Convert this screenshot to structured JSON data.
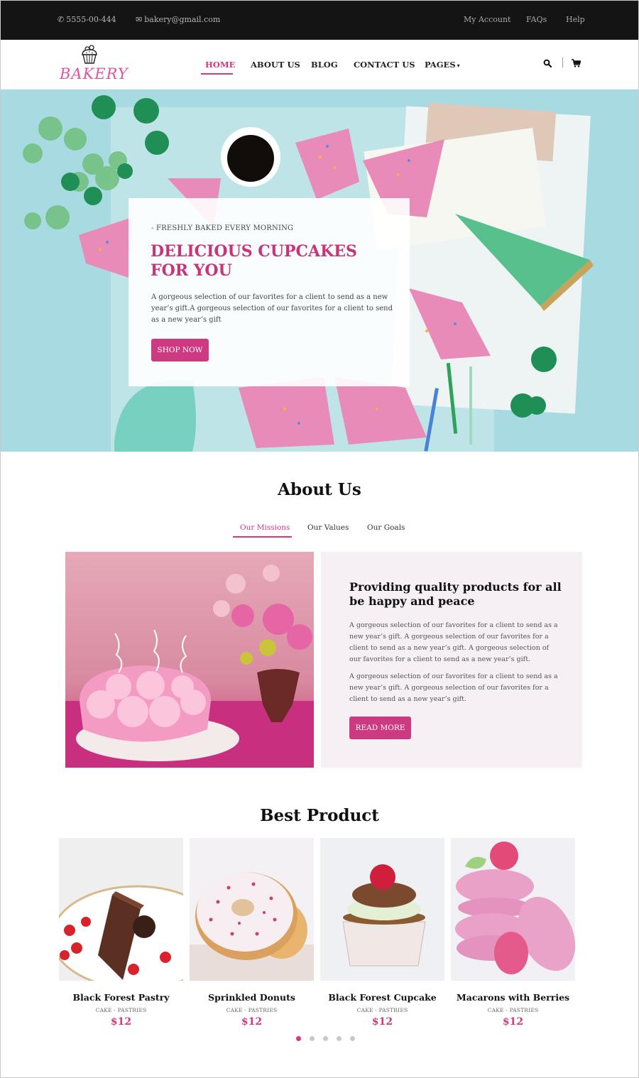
{
  "topbar": {
    "phone": "5555-00-444",
    "email": "bakery@gmail.com",
    "links": [
      "My Account",
      "FAQs",
      "Help"
    ]
  },
  "header": {
    "logo_text": "BAKERY",
    "nav": [
      {
        "label": "HOME",
        "active": true
      },
      {
        "label": "ABOUT US",
        "active": false
      },
      {
        "label": "BLOG",
        "active": false
      },
      {
        "label": "CONTACT US",
        "active": false
      },
      {
        "label": "PAGES",
        "active": false,
        "dropdown": true
      }
    ],
    "icons": [
      "search-icon",
      "cart-icon"
    ]
  },
  "hero": {
    "kicker": "- FRESHLY BAKED EVERY MORNING",
    "title": "DELICIOUS CUPCAKES FOR YOU",
    "body": "A gorgeous selection of our favorites for a client to send as a new year’s gift.A gorgeous selection of our favorites for a client to send as a new year’s gift",
    "button": "SHOP NOW"
  },
  "about": {
    "title": "About Us",
    "tabs": [
      {
        "label": "Our Missions",
        "active": true
      },
      {
        "label": "Our Values",
        "active": false
      },
      {
        "label": "Our Goals",
        "active": false
      }
    ],
    "heading": "Providing quality products for all be happy and peace",
    "paragraphs": [
      "A gorgeous selection of our favorites for a client to send as a new year’s gift. A gorgeous selection of our favorites for a client to send as a new year’s gift. A gorgeous selection of our favorites for a client to send as a new year’s gift.",
      "A gorgeous selection of our favorites for a client to send as a new year’s gift. A gorgeous selection of our favorites for a client to send as a new year’s gift."
    ],
    "button": "READ MORE"
  },
  "best": {
    "title": "Best Product",
    "products": [
      {
        "name": "Black Forest Pastry",
        "category": "CAKE - PASTRIES",
        "price": "$12"
      },
      {
        "name": "Sprinkled Donuts",
        "category": "CAKE - PASTRIES",
        "price": "$12"
      },
      {
        "name": "Black Forest Cupcake",
        "category": "CAKE - PASTRIES",
        "price": "$12"
      },
      {
        "name": "Macarons with Berries",
        "category": "CAKE - PASTRIES",
        "price": "$12"
      }
    ],
    "carousel": {
      "pages": 5,
      "active": 1
    }
  },
  "colors": {
    "accent": "#d6377f",
    "button": "#cd3a82",
    "topbar": "#141414",
    "about_panel": "#f6f0f4"
  }
}
